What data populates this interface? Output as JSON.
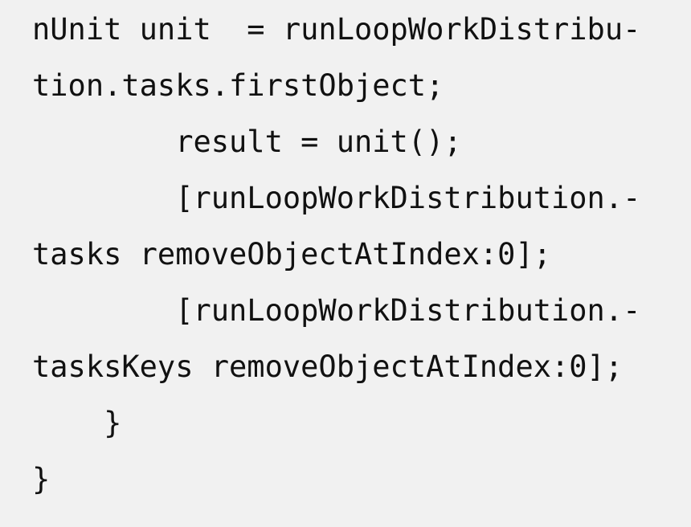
{
  "code": {
    "lines": [
      "nUnit unit  = runLoopWorkDistribu-",
      "tion.tasks.firstObject;",
      "        result = unit();",
      "        [runLoopWorkDistribution.-",
      "tasks removeObjectAtIndex:0];",
      "        [runLoopWorkDistribution.-",
      "tasksKeys removeObjectAtIndex:0];",
      "    }",
      "}"
    ]
  }
}
